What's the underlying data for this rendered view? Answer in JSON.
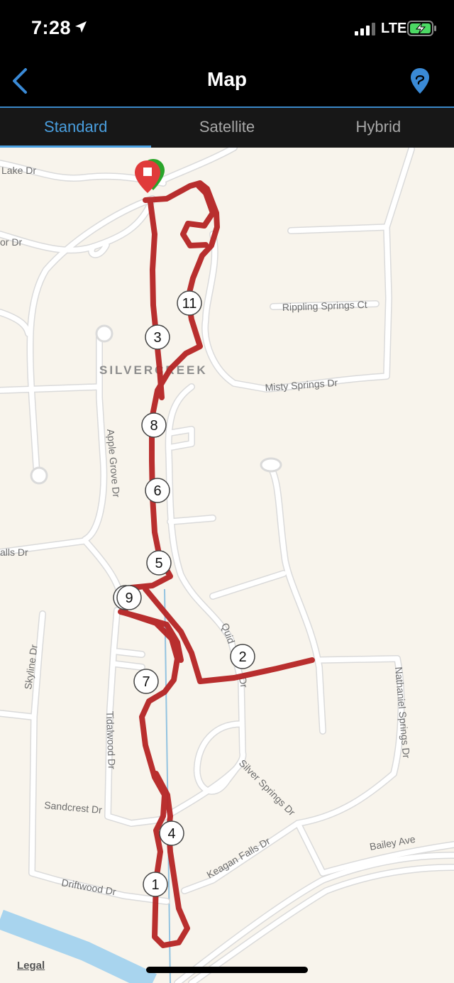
{
  "status_bar": {
    "time": "7:28",
    "carrier": "LTE",
    "signal_bars": 4,
    "battery_charging": true
  },
  "nav": {
    "title": "Map",
    "back_icon": "chevron-left-icon",
    "route_icon": "route-pin-icon",
    "accent_color": "#4a9fdf"
  },
  "tabs": [
    {
      "label": "Standard",
      "active": true
    },
    {
      "label": "Satellite",
      "active": false
    },
    {
      "label": "Hybrid",
      "active": false
    }
  ],
  "map": {
    "area_label": "SILVERCREEK",
    "streets": {
      "lake": "Lake Dr",
      "or": "or Dr",
      "rippling": "Rippling Springs Ct",
      "misty": "Misty Springs Dr",
      "apple_grove": "Apple Grove Dr",
      "falls": "alls Dr",
      "quid": "Quid",
      "quid_dr": "Dr",
      "skyline": "Skyline Dr",
      "tidalwood": "Tidalwood Dr",
      "nathaniel": "Nathaniel Springs Dr",
      "silver_springs": "Silver Springs Dr",
      "sandcrest": "Sandcrest Dr",
      "keagan": "Keagan Falls Dr",
      "bailey": "Bailey Ave",
      "driftwood": "Driftwood Dr"
    },
    "route_color": "#b22424",
    "mile_markers": [
      "1",
      "2",
      "3",
      "4",
      "5",
      "6",
      "7",
      "8",
      "9",
      "11"
    ],
    "legal_label": "Legal"
  }
}
